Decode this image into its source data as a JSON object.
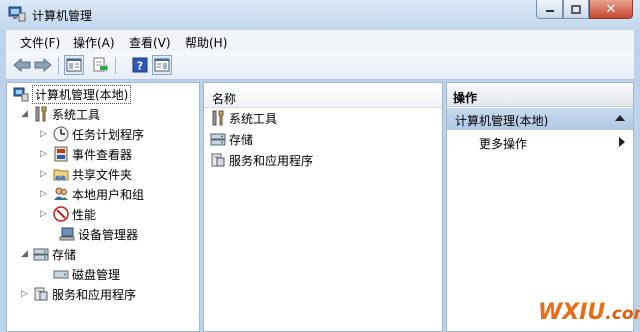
{
  "window": {
    "title": "计算机管理",
    "close_glyph": "✕"
  },
  "menu": [
    {
      "label": "文件(F)"
    },
    {
      "label": "操作(A)"
    },
    {
      "label": "查看(V)"
    },
    {
      "label": "帮助(H)"
    }
  ],
  "toolbar": {
    "buttons": [
      "back-icon",
      "forward-icon",
      "show-hide-tree-icon",
      "export-list-icon",
      "help-icon",
      "show-hide-action-pane-icon"
    ]
  },
  "tree": {
    "root": "计算机管理(本地)",
    "system_tools": "系统工具",
    "task_scheduler": "任务计划程序",
    "event_viewer": "事件查看器",
    "shared_folders": "共享文件夹",
    "local_users": "本地用户和组",
    "performance": "性能",
    "device_manager": "设备管理器",
    "storage": "存储",
    "disk_management": "磁盘管理",
    "services_apps": "服务和应用程序"
  },
  "center": {
    "column_header": "名称",
    "items": [
      "系统工具",
      "存储",
      "服务和应用程序"
    ]
  },
  "actions": {
    "header": "操作",
    "selected": "计算机管理(本地)",
    "more": "更多操作"
  },
  "watermark": {
    "main": "WXIU",
    "suffix": ".com"
  },
  "colors": {
    "accent": "#b1c9e5",
    "watermark": "#e86d16",
    "close": "#c84530"
  }
}
